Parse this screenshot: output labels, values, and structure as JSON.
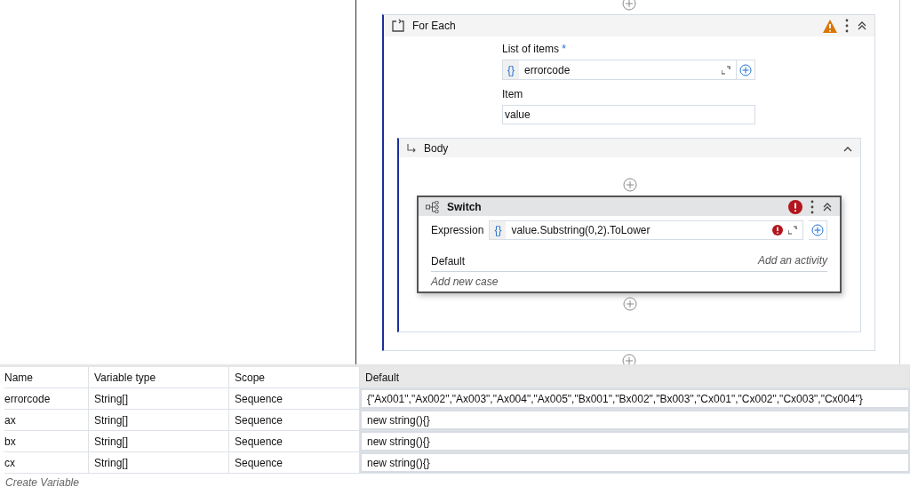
{
  "for_each": {
    "title": "For Each",
    "warning": true,
    "list_label": "List of items",
    "required_mark": "*",
    "list_prefix": "{}",
    "list_value": "errorcode",
    "item_label": "Item",
    "item_value": "value",
    "body": {
      "title": "Body",
      "switch": {
        "title": "Switch",
        "error": true,
        "expression_label": "Expression",
        "expression_prefix": "{}",
        "expression_value": "value.Substring(0,2).ToLower",
        "expression_error": true,
        "default_label": "Default",
        "default_action": "Add an activity",
        "add_case": "Add new case"
      }
    }
  },
  "variables": {
    "columns": [
      "Name",
      "Variable type",
      "Scope",
      "Default"
    ],
    "rows": [
      {
        "name": "errorcode",
        "type": "String[]",
        "scope": "Sequence",
        "default": "{\"Ax001\",\"Ax002\",\"Ax003\",\"Ax004\",\"Ax005\",\"Bx001\",\"Bx002\",\"Bx003\",\"Cx001\",\"Cx002\",\"Cx003\",\"Cx004\"}"
      },
      {
        "name": "ax",
        "type": "String[]",
        "scope": "Sequence",
        "default": "new string(){}"
      },
      {
        "name": "bx",
        "type": "String[]",
        "scope": "Sequence",
        "default": "new string(){}"
      },
      {
        "name": "cx",
        "type": "String[]",
        "scope": "Sequence",
        "default": "new string(){}"
      }
    ],
    "create": "Create Variable"
  }
}
